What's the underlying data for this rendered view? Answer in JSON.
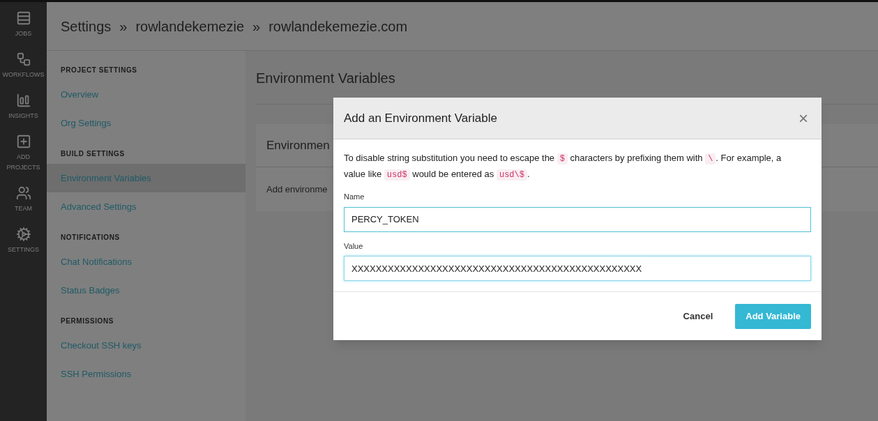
{
  "nav": [
    {
      "kind": "jobs",
      "label": "JOBS"
    },
    {
      "kind": "workflows",
      "label": "WORKFLOWS"
    },
    {
      "kind": "insights",
      "label": "INSIGHTS"
    },
    {
      "kind": "add",
      "label": "ADD PROJECTS"
    },
    {
      "kind": "team",
      "label": "TEAM"
    },
    {
      "kind": "settings",
      "label": "SETTINGS"
    }
  ],
  "breadcrumb": [
    "Settings",
    "rowlandekemezie",
    "rowlandekemezie.com"
  ],
  "breadcrumb_separator": "»",
  "sidebar": [
    {
      "heading": "PROJECT SETTINGS",
      "items": [
        {
          "label": "Overview",
          "selected": false
        },
        {
          "label": "Org Settings",
          "selected": false
        }
      ]
    },
    {
      "heading": "BUILD SETTINGS",
      "items": [
        {
          "label": "Environment Variables",
          "selected": true
        },
        {
          "label": "Advanced Settings",
          "selected": false
        }
      ]
    },
    {
      "heading": "NOTIFICATIONS",
      "items": [
        {
          "label": "Chat Notifications",
          "selected": false
        },
        {
          "label": "Status Badges",
          "selected": false
        }
      ]
    },
    {
      "heading": "PERMISSIONS",
      "items": [
        {
          "label": "Checkout SSH keys",
          "selected": false
        },
        {
          "label": "SSH Permissions",
          "selected": false
        }
      ]
    }
  ],
  "page_title": "Environment Variables",
  "card": {
    "title": "Environmen",
    "text": "Add environme"
  },
  "dialog": {
    "title": "Add an Environment Variable",
    "close": "×",
    "description": [
      {
        "kind": "text",
        "text": "To disable string substitution you need to escape the "
      },
      {
        "kind": "code",
        "text": "$"
      },
      {
        "kind": "text",
        "text": " characters by prefixing them with "
      },
      {
        "kind": "code",
        "text": "\\"
      },
      {
        "kind": "text",
        "text": ". For example, a value like "
      },
      {
        "kind": "code",
        "text": "usd$"
      },
      {
        "kind": "text",
        "text": " would be entered as "
      },
      {
        "kind": "code",
        "text": "usd\\$"
      },
      {
        "kind": "text",
        "text": "."
      }
    ],
    "fields": [
      {
        "label": "Name",
        "value": "PERCY_TOKEN",
        "focused": false
      },
      {
        "label": "Value",
        "value": "XXXXXXXXXXXXXXXXXXXXXXXXXXXXXXXXXXXXXXXXXXXXXXXX",
        "focused": true
      }
    ],
    "cancel": "Cancel",
    "submit": "Add Variable"
  }
}
